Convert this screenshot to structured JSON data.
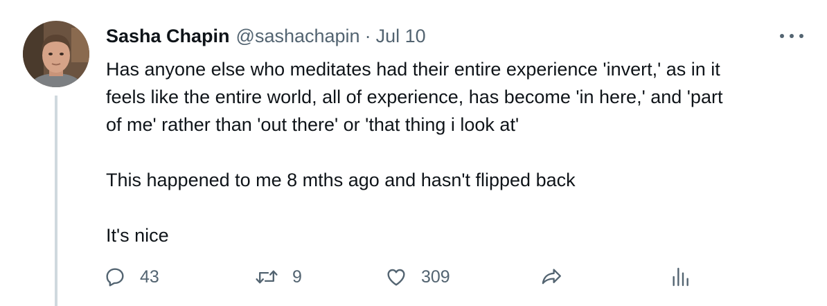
{
  "tweet": {
    "author_name": "Sasha Chapin",
    "author_handle": "@sashachapin",
    "separator": "·",
    "date": "Jul 10",
    "text_lines": [
      "Has anyone else who meditates had their entire experience 'invert,' as in it",
      "feels like the entire world, all of experience, has become 'in here,' and 'part",
      "of me' rather than 'out there' or 'that thing i look at'"
    ],
    "paragraph_2": "This happened to me 8 mths ago and hasn't flipped back",
    "paragraph_3": "It's nice"
  },
  "actions": {
    "reply": {
      "icon": "reply-icon",
      "count": "43"
    },
    "retweet": {
      "icon": "retweet-icon",
      "count": "9"
    },
    "like": {
      "icon": "heart-icon",
      "count": "309"
    },
    "share": {
      "icon": "share-icon"
    },
    "analytics": {
      "icon": "analytics-icon"
    }
  },
  "colors": {
    "text_primary": "#0f1419",
    "text_secondary": "#536471",
    "thread_line": "#cfd9de",
    "background": "#ffffff"
  }
}
